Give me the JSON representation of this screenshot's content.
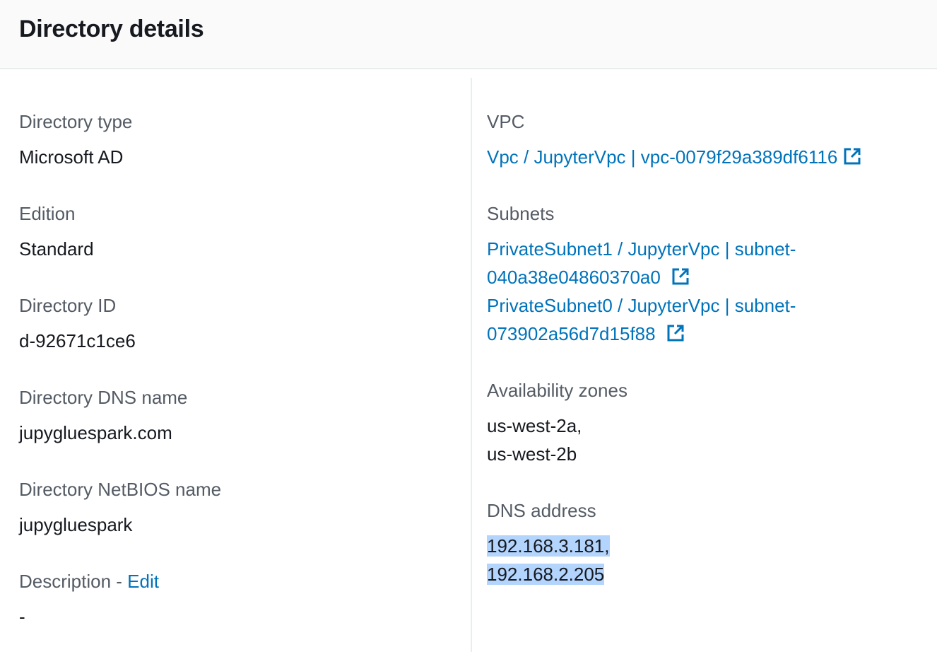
{
  "header": {
    "title": "Directory details"
  },
  "left": {
    "directory_type": {
      "label": "Directory type",
      "value": "Microsoft AD"
    },
    "edition": {
      "label": "Edition",
      "value": "Standard"
    },
    "directory_id": {
      "label": "Directory ID",
      "value": "d-92671c1ce6"
    },
    "dns_name": {
      "label": "Directory DNS name",
      "value": "jupygluespark.com"
    },
    "netbios_name": {
      "label": "Directory NetBIOS name",
      "value": "jupygluespark"
    },
    "description": {
      "label": "Description - ",
      "edit_link": "Edit",
      "value": "-"
    }
  },
  "right": {
    "vpc": {
      "label": "VPC",
      "link": "Vpc / JupyterVpc | vpc-0079f29a389df6116",
      "icon": "external-link-icon"
    },
    "subnets": {
      "label": "Subnets",
      "items": [
        {
          "line1": "PrivateSubnet1 / JupyterVpc | subnet-",
          "line2": "040a38e04860370a0",
          "icon": "external-link-icon"
        },
        {
          "line1": "PrivateSubnet0 / JupyterVpc | subnet-",
          "line2": "073902a56d7d15f88",
          "icon": "external-link-icon"
        }
      ]
    },
    "availability_zones": {
      "label": "Availability zones",
      "values": [
        "us-west-2a,",
        "us-west-2b"
      ]
    },
    "dns_address": {
      "label": "DNS address",
      "values": [
        "192.168.3.181,",
        "192.168.2.205"
      ]
    }
  },
  "colors": {
    "link": "#0073bb",
    "label": "#545b64",
    "text": "#16191f",
    "selection": "#b3d4fc",
    "header_bg": "#fafafa",
    "divider": "#eaeded"
  }
}
